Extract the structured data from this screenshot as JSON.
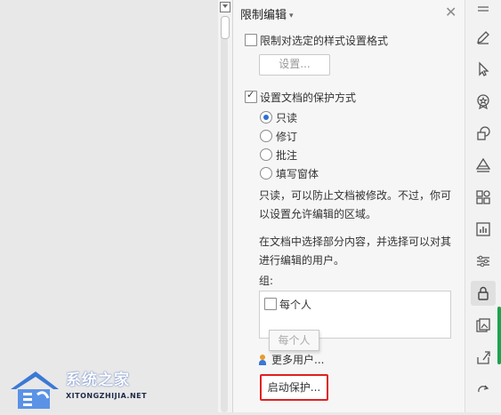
{
  "panel": {
    "title": "限制编辑",
    "close_icon": "close-icon",
    "format_restriction": {
      "label": "限制对选定的样式设置格式",
      "checked": false
    },
    "settings_button": "设置...",
    "protection": {
      "label": "设置文档的保护方式",
      "checked": true,
      "options": [
        {
          "label": "只读",
          "selected": true
        },
        {
          "label": "修订",
          "selected": false
        },
        {
          "label": "批注",
          "selected": false
        },
        {
          "label": "填写窗体",
          "selected": false
        }
      ]
    },
    "readonly_help": "只读，可以防止文档被修改。不过，你可以设置允许编辑的区域。",
    "select_help": "在文档中选择部分内容，并选择可以对其进行编辑的用户。",
    "group_label": "组:",
    "group_items": [
      {
        "label": "每个人",
        "checked": false
      }
    ],
    "tooltip": "每个人",
    "more_users": "更多用户...",
    "start_protection": "启动保护..."
  },
  "toolbar": {
    "icons": [
      "pen-icon",
      "pointer-icon",
      "badge-icon",
      "shapes-icon",
      "layers-icon",
      "apps-icon",
      "chart-icon",
      "sliders-icon",
      "lock-icon",
      "image-icon",
      "share-icon",
      "redo-icon"
    ],
    "active": "lock-icon",
    "scroll_color": "#1aa44d"
  },
  "watermark": {
    "title": "系统之家",
    "subtitle": "XITONGZHIJIA.NET"
  },
  "colors": {
    "accent": "#2b6fd6",
    "highlight": "#e02020"
  }
}
